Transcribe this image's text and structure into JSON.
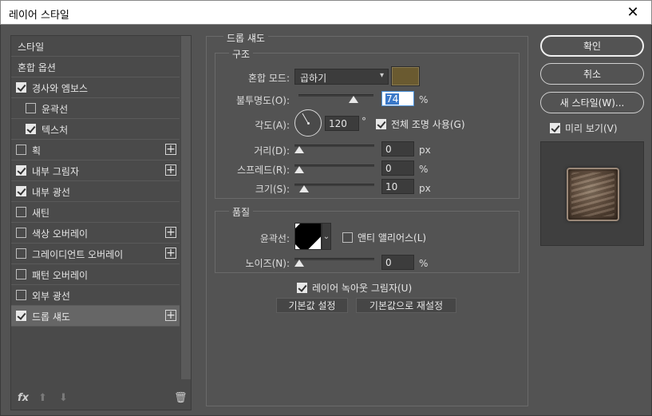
{
  "window": {
    "title": "레이어 스타일",
    "close_glyph": "✕"
  },
  "styles_list": {
    "items": [
      {
        "label": "스타일",
        "has_checkbox": false,
        "checked": false,
        "has_plus": false,
        "indent": 0
      },
      {
        "label": "혼합 옵션",
        "has_checkbox": false,
        "checked": false,
        "has_plus": false,
        "indent": 0
      },
      {
        "label": "경사와 엠보스",
        "has_checkbox": true,
        "checked": true,
        "has_plus": false,
        "indent": 0
      },
      {
        "label": "윤곽선",
        "has_checkbox": true,
        "checked": false,
        "has_plus": false,
        "indent": 1
      },
      {
        "label": "텍스처",
        "has_checkbox": true,
        "checked": true,
        "has_plus": false,
        "indent": 1
      },
      {
        "label": "획",
        "has_checkbox": true,
        "checked": false,
        "has_plus": true,
        "indent": 0
      },
      {
        "label": "내부 그림자",
        "has_checkbox": true,
        "checked": true,
        "has_plus": true,
        "indent": 0
      },
      {
        "label": "내부 광선",
        "has_checkbox": true,
        "checked": true,
        "has_plus": false,
        "indent": 0
      },
      {
        "label": "새틴",
        "has_checkbox": true,
        "checked": false,
        "has_plus": false,
        "indent": 0
      },
      {
        "label": "색상 오버레이",
        "has_checkbox": true,
        "checked": false,
        "has_plus": true,
        "indent": 0
      },
      {
        "label": "그레이디언트 오버레이",
        "has_checkbox": true,
        "checked": false,
        "has_plus": true,
        "indent": 0
      },
      {
        "label": "패턴 오버레이",
        "has_checkbox": true,
        "checked": false,
        "has_plus": false,
        "indent": 0
      },
      {
        "label": "외부 광선",
        "has_checkbox": true,
        "checked": false,
        "has_plus": false,
        "indent": 0
      },
      {
        "label": "드롭 섀도",
        "has_checkbox": true,
        "checked": true,
        "has_plus": true,
        "indent": 0,
        "selected": true
      }
    ],
    "tools": {
      "fx": "fx",
      "up": "⬆",
      "down": "⬇",
      "trash": "🗑"
    }
  },
  "drop_shadow": {
    "section_title": "드롭 섀도",
    "structure": {
      "title": "구조",
      "blend_mode_label": "혼합 모드:",
      "blend_mode_value": "곱하기",
      "blend_color": "#6a5a30",
      "opacity_label": "불투명도(O):",
      "opacity_value": "74",
      "opacity_unit": "%",
      "angle_label": "각도(A):",
      "angle_value": "120",
      "angle_unit": "°",
      "global_light_label": "전체 조명 사용(G)",
      "global_light_checked": true,
      "distance_label": "거리(D):",
      "distance_value": "0",
      "distance_unit": "px",
      "spread_label": "스프레드(R):",
      "spread_value": "0",
      "spread_unit": "%",
      "size_label": "크기(S):",
      "size_value": "10",
      "size_unit": "px"
    },
    "quality": {
      "title": "품질",
      "contour_label": "윤곽선:",
      "antialias_label": "앤티 앨리어스(L)",
      "antialias_checked": false,
      "noise_label": "노이즈(N):",
      "noise_value": "0",
      "noise_unit": "%"
    },
    "knockout_label": "레이어 녹아웃 그림자(U)",
    "knockout_checked": true,
    "make_default": "기본값 설정",
    "reset_default": "기본값으로 재설정"
  },
  "buttons": {
    "ok": "확인",
    "cancel": "취소",
    "new_style": "새 스타일(W)...",
    "preview_label": "미리 보기(V)",
    "preview_checked": true
  }
}
